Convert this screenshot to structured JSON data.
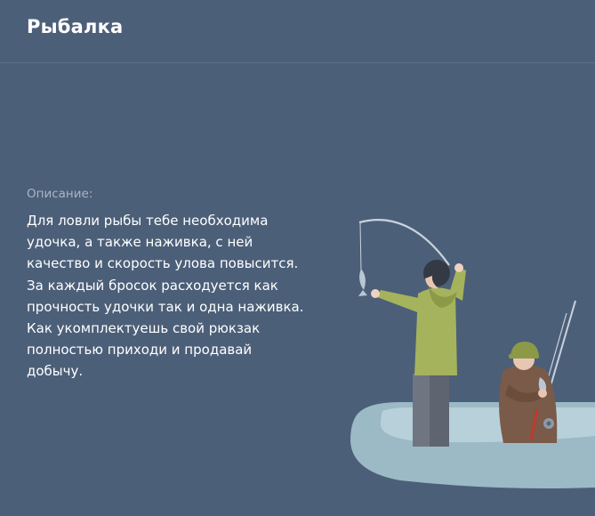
{
  "header": {
    "title": "Рыбалка"
  },
  "description": {
    "label": "Описание:",
    "text": "Для ловли рыбы тебе необходима\nудочка, а также наживка, с ней\nкачество и скорость улова повысится.\nЗа каждый бросок расходуется как\nпрочность удочки так и одна наживка.\nКак укомплектуешь свой рюкзак\nполностью приходи и продавай\nдобычу."
  },
  "illustration": {
    "icon": "fishing-boat-illustration"
  },
  "colors": {
    "background": "#4c5f78",
    "boat": "#9bbac6",
    "jacket_green": "#a5b35d",
    "jacket_brown": "#7a5a48"
  }
}
